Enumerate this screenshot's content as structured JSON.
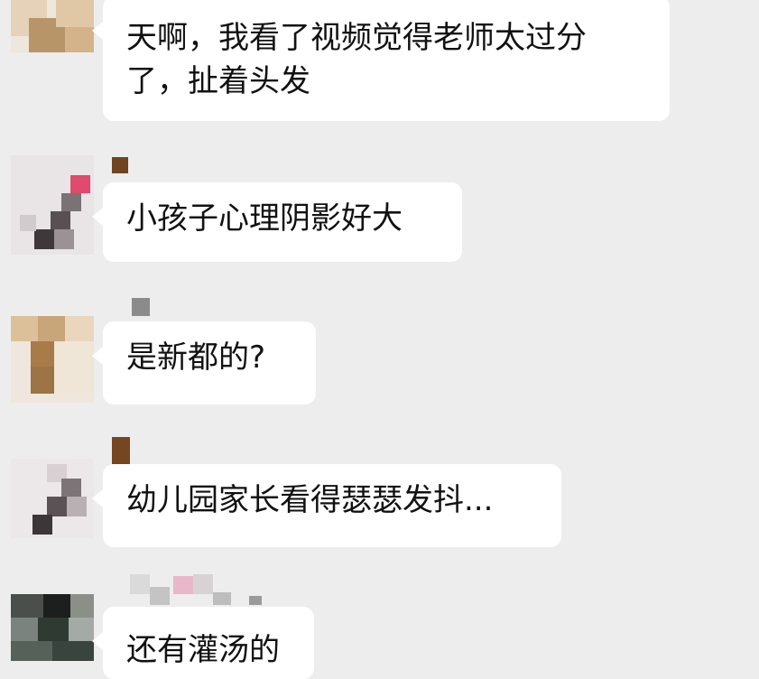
{
  "messages": [
    {
      "text": "天啊，我看了视频觉得老师太过分了，扯着头发"
    },
    {
      "text": "小孩子心理阴影好大"
    },
    {
      "text": "是新都的?"
    },
    {
      "text": "幼儿园家长看得瑟瑟发抖..."
    },
    {
      "text": "还有灌汤的"
    }
  ],
  "colors": {
    "background": "#ededed",
    "bubble": "#ffffff",
    "text": "#111111"
  }
}
